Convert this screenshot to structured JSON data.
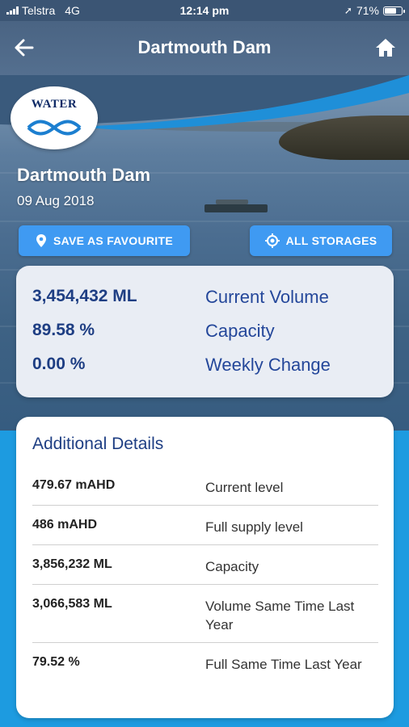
{
  "status_bar": {
    "carrier": "Telstra",
    "network": "4G",
    "time": "12:14 pm",
    "battery": "71%",
    "battery_level": 0.71
  },
  "app_bar": {
    "title": "Dartmouth Dam",
    "back_icon": "arrow-left-icon",
    "home_icon": "home-icon"
  },
  "hero": {
    "logo_text": "WATER",
    "storage_name": "Dartmouth Dam",
    "date": "09 Aug 2018"
  },
  "actions": {
    "save_favourite": "SAVE AS FAVOURITE",
    "all_storages": "ALL STORAGES"
  },
  "summary": [
    {
      "value": "3,454,432 ML",
      "label": "Current Volume"
    },
    {
      "value": "89.58 %",
      "label": "Capacity"
    },
    {
      "value": "0.00 %",
      "label": "Weekly Change"
    }
  ],
  "details": {
    "heading": "Additional Details",
    "rows": [
      {
        "value": "479.67 mAHD",
        "label": "Current level"
      },
      {
        "value": "486 mAHD",
        "label": "Full supply level"
      },
      {
        "value": "3,856,232 ML",
        "label": "Capacity"
      },
      {
        "value": "3,066,583 ML",
        "label": "Volume Same Time Last Year"
      },
      {
        "value": "79.52 %",
        "label": "Full Same Time Last Year"
      }
    ]
  },
  "colors": {
    "app_bar": "#4a6483",
    "accent_button": "#3f9af2",
    "value_text": "#1e3e83",
    "background": "#1d9be0"
  }
}
